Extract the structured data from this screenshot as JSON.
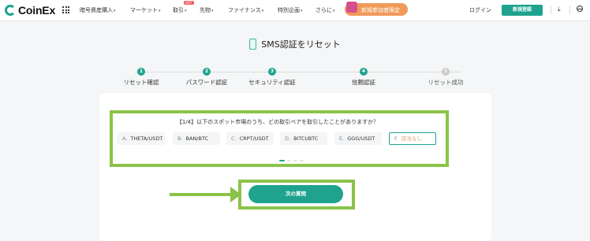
{
  "brand": {
    "name": "CoinEx"
  },
  "nav": {
    "items": [
      {
        "label": "暗号資産購入",
        "caret": "▾"
      },
      {
        "label": "マーケット",
        "caret": "▾"
      },
      {
        "label": "取引",
        "caret": "▾",
        "badge": "HOT"
      },
      {
        "label": "先物",
        "caret": "▾"
      },
      {
        "label": "ファイナンス",
        "caret": "▾"
      },
      {
        "label": "特別企画",
        "caret": "▾"
      },
      {
        "label": "さらに",
        "caret": "▾"
      }
    ],
    "promo": "新規参加者限定",
    "login": "ログイン",
    "signup": "新規登録",
    "download_icon": "⤓"
  },
  "page": {
    "title": "SMS認証をリセット"
  },
  "steps": [
    {
      "num": "1",
      "label": "リセット確認",
      "done": true
    },
    {
      "num": "2",
      "label": "パスワード認証",
      "done": true
    },
    {
      "num": "3",
      "label": "セキュリティ認証",
      "done": true
    },
    {
      "num": "4",
      "label": "信頼認証",
      "done": true
    },
    {
      "num": "5",
      "label": "リセット成功",
      "done": false
    }
  ],
  "question": {
    "text": "【1/4】以下のスポット市場のうち、どの取引ペアを取引したことがありますか？",
    "options": [
      {
        "key": "A.",
        "value": "THETA/USDT"
      },
      {
        "key": "B.",
        "value": "BAN/BTC"
      },
      {
        "key": "C.",
        "value": "CRPT/USDT"
      },
      {
        "key": "D.",
        "value": "BITCI/BTC"
      },
      {
        "key": "E.",
        "value": "GGG/USDT"
      },
      {
        "key": "F.",
        "value": "該当なし"
      }
    ],
    "selected": "F."
  },
  "next_button": {
    "label": "次の質問"
  },
  "colors": {
    "accent": "#1fa38e",
    "highlight": "#8bc34a"
  }
}
